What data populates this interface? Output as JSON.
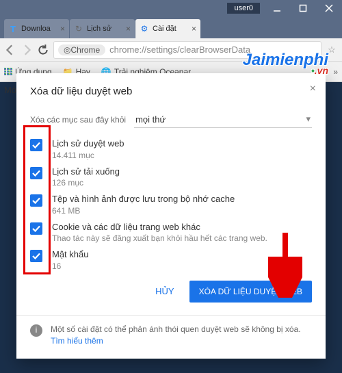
{
  "window": {
    "user_label": "user0"
  },
  "tabs": [
    {
      "label": "Downloa",
      "favicon_color": "#3aa0ff",
      "favicon_glyph": "T"
    },
    {
      "label": "Lịch sử",
      "favicon_glyph": "↻"
    },
    {
      "label": "Cài đặt",
      "favicon_glyph": "⚙",
      "active": true
    }
  ],
  "address_bar": {
    "origin_chip": "Chrome",
    "url": "chrome://settings/clearBrowserData"
  },
  "bookmark_bar": {
    "apps_label": "Ứng dụng",
    "items": [
      "Hay",
      "Trải nghiệm Oceanar"
    ]
  },
  "side_label": "Mớ",
  "dialog": {
    "title": "Xóa dữ liệu duyệt web",
    "subheading": "Xóa các mục sau đây khỏi",
    "timeframe": "mọi thứ",
    "options": [
      {
        "title": "Lịch sử duyệt web",
        "sub": "14.411 mục",
        "checked": true
      },
      {
        "title": "Lịch sử tải xuống",
        "sub": "126 mục",
        "checked": true
      },
      {
        "title": "Tệp và hình ảnh được lưu trong bộ nhớ cache",
        "sub": "641 MB",
        "checked": true
      },
      {
        "title": "Cookie và các dữ liệu trang web khác",
        "sub": "Thao tác này sẽ đăng xuất bạn khỏi hầu hết các trang web.",
        "checked": true
      },
      {
        "title": "Mật khẩu",
        "sub": "16",
        "checked": true
      }
    ],
    "cancel_label": "HỦY",
    "clear_label": "XÓA DỮ LIỆU DUYỆT WEB",
    "footer_text": "Một số cài đặt có thể phản ánh thói quen duyệt web sẽ không bị xóa.",
    "learn_more": "Tìm hiểu thêm"
  },
  "watermark": {
    "text": "Jaimienphi",
    "suffix": ".vn"
  }
}
